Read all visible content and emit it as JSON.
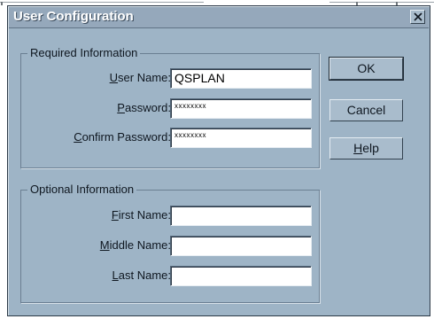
{
  "dialog": {
    "title": "User Configuration",
    "close_glyph": "×",
    "close_icon": "close-icon"
  },
  "required_group": {
    "legend": "Required Information",
    "fields": [
      {
        "key": "U",
        "rest": "ser Name:",
        "value": "QSPLAN",
        "masked": false
      },
      {
        "key": "P",
        "rest": "assword:",
        "value": "xxxxxxxx",
        "masked": true
      },
      {
        "key": "C",
        "rest": "onfirm Password:",
        "value": "xxxxxxxx",
        "masked": true
      }
    ]
  },
  "optional_group": {
    "legend": "Optional Information",
    "fields": [
      {
        "key": "F",
        "rest": "irst Name:",
        "value": ""
      },
      {
        "key": "M",
        "rest": "iddle Name:",
        "value": ""
      },
      {
        "key": "L",
        "rest": "ast Name:",
        "value": ""
      }
    ]
  },
  "buttons": {
    "ok": {
      "label": "OK"
    },
    "cancel": {
      "label": "Cancel"
    },
    "help": {
      "key": "H",
      "rest": "elp"
    }
  },
  "colors": {
    "dialog_bg": "#9eb4c6",
    "title_bg": "#95a8bb",
    "title_text": "#ffffff",
    "input_bg": "#ffffff"
  }
}
